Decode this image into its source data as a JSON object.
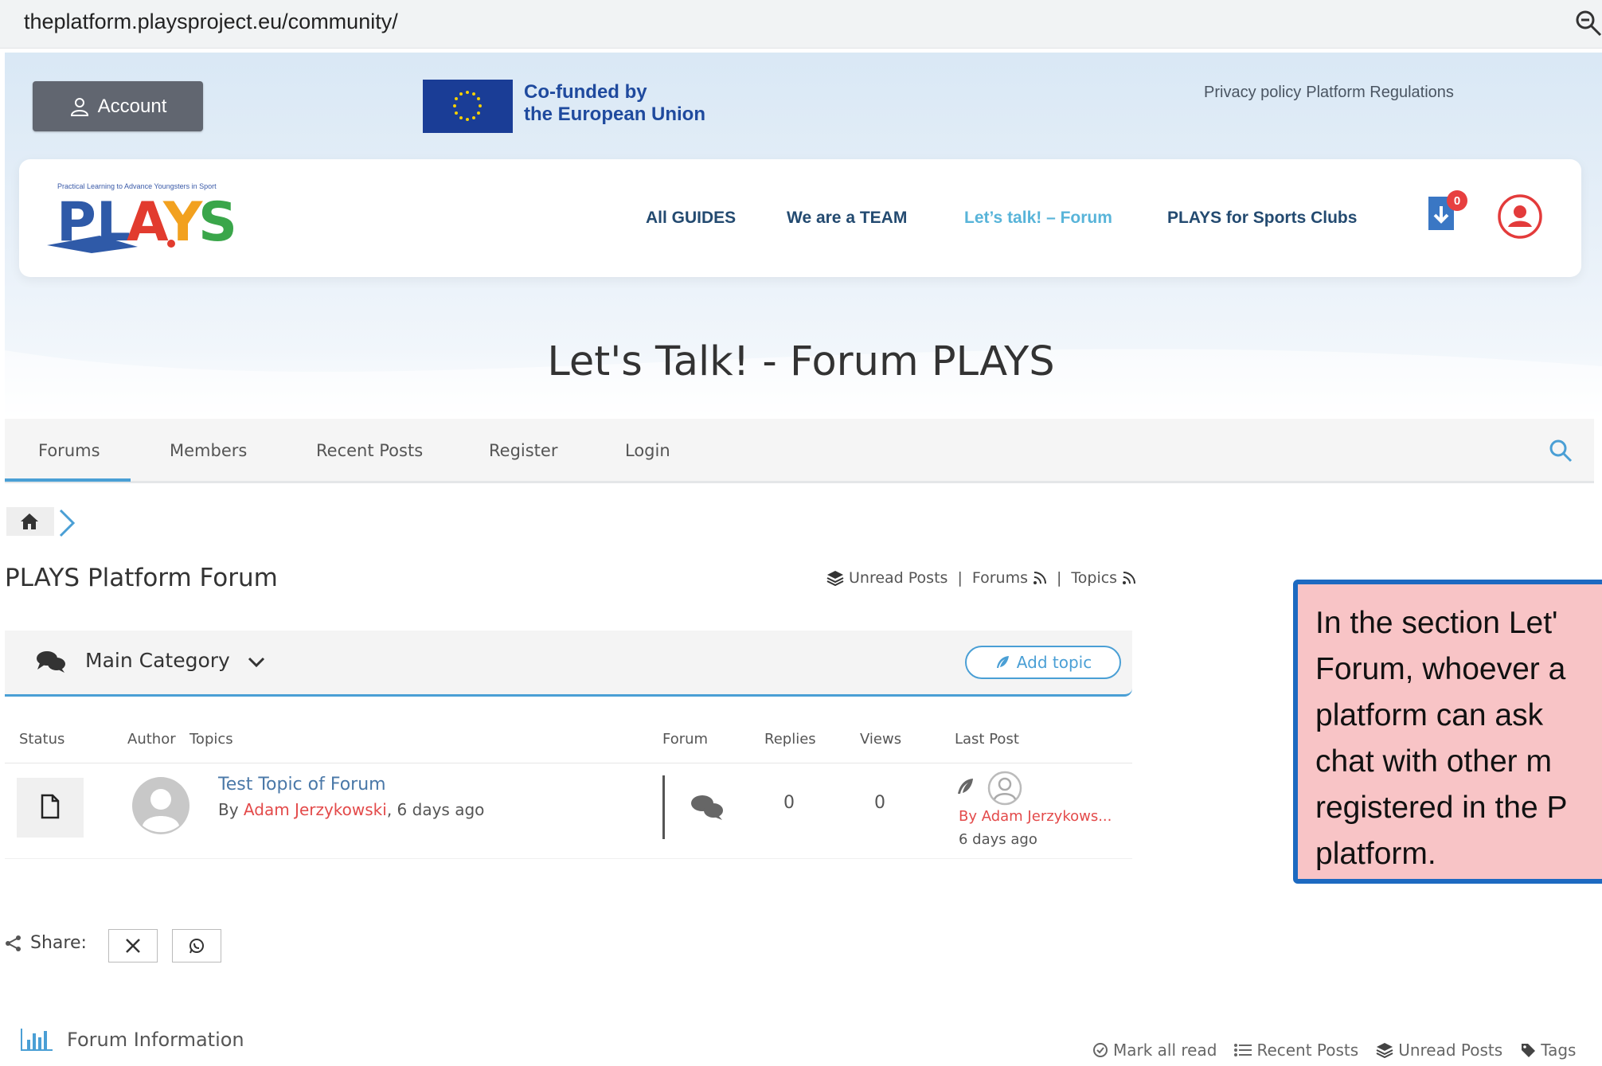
{
  "browser": {
    "url": "theplatform.playsproject.eu/community/"
  },
  "header": {
    "account_label": "Account",
    "eu_line1": "Co-funded by",
    "eu_line2": "the European Union",
    "top_links": [
      "Privacy policy",
      "Platform Regulations"
    ]
  },
  "logo": {
    "tagline": "Practical Learning to Advance Youngsters in Sport",
    "text": "PLAYS"
  },
  "nav": {
    "items": [
      {
        "label": "All GUIDES"
      },
      {
        "label": "We are a TEAM"
      },
      {
        "label": "Let’s talk! – Forum",
        "active": true
      },
      {
        "label": "PLAYS for Sports Clubs"
      }
    ],
    "download_badge": "0"
  },
  "page": {
    "title": "Let's Talk! - Forum PLAYS"
  },
  "tabs": [
    {
      "label": "Forums",
      "active": true
    },
    {
      "label": "Members"
    },
    {
      "label": "Recent Posts"
    },
    {
      "label": "Register"
    },
    {
      "label": "Login"
    }
  ],
  "forum": {
    "title": "PLAYS Platform Forum",
    "links": {
      "unread": "Unread Posts",
      "forums": "Forums",
      "topics": "Topics"
    },
    "category": "Main Category",
    "add_topic": "Add topic",
    "columns": {
      "status": "Status",
      "author": "Author",
      "topics": "Topics",
      "forum": "Forum",
      "replies": "Replies",
      "views": "Views",
      "last_post": "Last Post"
    },
    "rows": [
      {
        "topic": "Test Topic of Forum",
        "by_prefix": "By",
        "author": "Adam Jerzykowski",
        "time": ", 6 days ago",
        "replies": "0",
        "views": "0",
        "last_post_by": "By Adam Jerzykows...",
        "last_post_time": "6 days ago"
      }
    ]
  },
  "share": {
    "label": "Share:"
  },
  "footer": {
    "info_label": "Forum Information",
    "links": [
      "Mark all read",
      "Recent Posts",
      "Unread Posts",
      "Tags"
    ]
  },
  "callout": {
    "text": "In the section Let'\nForum, whoever a\nplatform can ask \nchat with other m\nregistered in the P\nplatform."
  },
  "colors": {
    "accent": "#4a9fd5",
    "nav_text": "#234a70",
    "active_nav": "#58b4d9",
    "author_red": "#e34a4a",
    "callout_bg": "#f8c4c6",
    "callout_border": "#1d6ac1"
  }
}
